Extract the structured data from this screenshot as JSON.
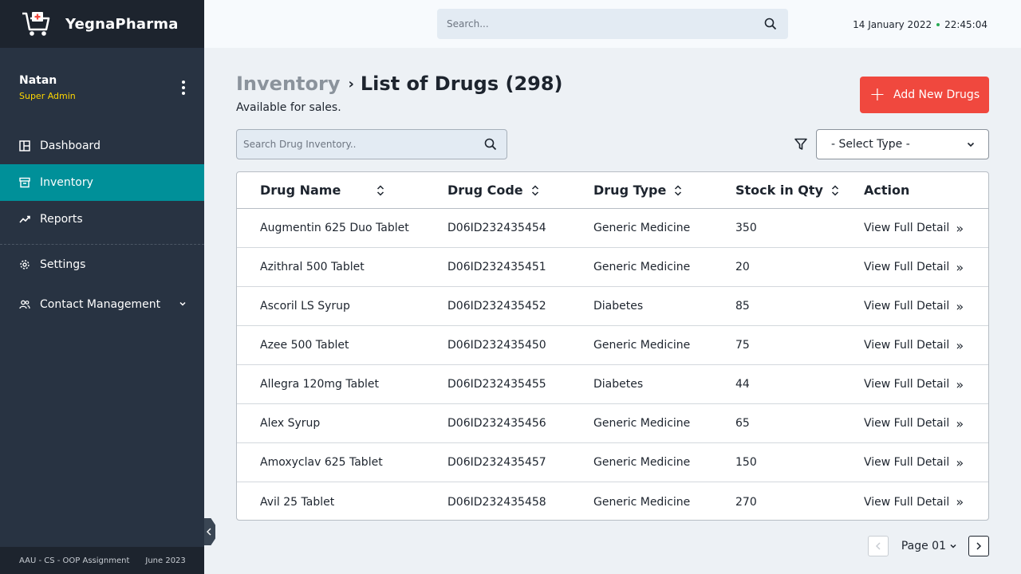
{
  "app": {
    "brand": "YegnaPharma"
  },
  "user": {
    "name": "Natan",
    "role": "Super Admin"
  },
  "sidebar": {
    "items": [
      {
        "label": "Dashboard",
        "icon": "dashboard-icon"
      },
      {
        "label": "Inventory",
        "icon": "archive-icon",
        "active": true
      },
      {
        "label": "Reports",
        "icon": "trend-line-icon"
      },
      {
        "label": "Settings",
        "icon": "gear-icon"
      },
      {
        "label": "Contact Management",
        "icon": "users-icon"
      }
    ],
    "footer_left": "AAU - CS - OOP Assignment",
    "footer_right": "June 2023"
  },
  "topbar": {
    "search_placeholder": "Search...",
    "date": "14 January 2022",
    "time": "22:45:04"
  },
  "page": {
    "breadcrumb_root": "Inventory",
    "title": "List of Drugs (298)",
    "subtitle": "Available for sales.",
    "add_button": "Add New Drugs",
    "search_placeholder": "Search Drug Inventory..",
    "type_select": "- Select Type -"
  },
  "table": {
    "headers": [
      "Drug Name",
      "Drug Code",
      "Drug Type",
      "Stock in Qty",
      "Action"
    ],
    "rows": [
      {
        "name": "Augmentin 625 Duo Tablet",
        "code": "D06ID232435454",
        "type": "Generic Medicine",
        "qty": "350",
        "action": "View Full Detail"
      },
      {
        "name": "Azithral 500 Tablet",
        "code": "D06ID232435451",
        "type": "Generic Medicine",
        "qty": "20",
        "action": "View Full Detail"
      },
      {
        "name": "Ascoril LS Syrup",
        "code": "D06ID232435452",
        "type": "Diabetes",
        "qty": "85",
        "action": "View Full Detail"
      },
      {
        "name": "Azee 500 Tablet",
        "code": "D06ID232435450",
        "type": "Generic Medicine",
        "qty": "75",
        "action": "View Full Detail"
      },
      {
        "name": "Allegra 120mg Tablet",
        "code": "D06ID232435455",
        "type": "Diabetes",
        "qty": "44",
        "action": "View Full Detail"
      },
      {
        "name": "Alex Syrup",
        "code": "D06ID232435456",
        "type": "Generic Medicine",
        "qty": "65",
        "action": "View Full Detail"
      },
      {
        "name": "Amoxyclav 625 Tablet",
        "code": "D06ID232435457",
        "type": "Generic Medicine",
        "qty": "150",
        "action": "View Full Detail"
      },
      {
        "name": "Avil 25 Tablet",
        "code": "D06ID232435458",
        "type": "Generic Medicine",
        "qty": "270",
        "action": "View Full Detail"
      }
    ]
  },
  "pagination": {
    "label": "Page 01"
  },
  "colors": {
    "sidebar": "#283342",
    "sidebar_dark": "#1D242E",
    "active": "#009099",
    "accent": "#F0483E",
    "role": "#FED600"
  }
}
